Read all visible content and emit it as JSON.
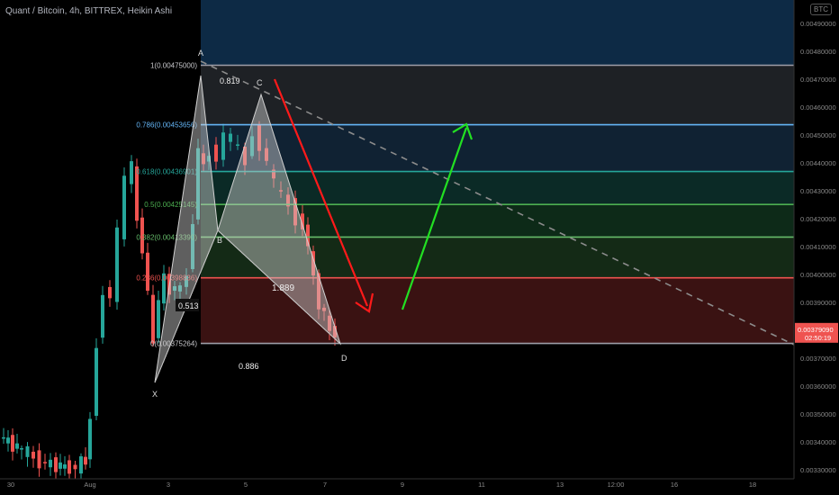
{
  "header": {
    "title": "Quant / Bitcoin, 4h, BITTREX, Heikin Ashi",
    "currency_button": "BTC"
  },
  "chart_data": {
    "type": "candlestick",
    "title": "Quant / Bitcoin, 4h, BITTREX, Heikin Ashi",
    "x_ticks": [
      "30",
      "Aug",
      "3",
      "5",
      "7",
      "9",
      "11",
      "13",
      "12:00",
      "16",
      "18"
    ],
    "y_ticks": [
      "0.00490000",
      "0.00480000",
      "0.00470000",
      "0.00460000",
      "0.00450000",
      "0.00440000",
      "0.00430000",
      "0.00420000",
      "0.00410000",
      "0.00400000",
      "0.00390000",
      "0.00380000",
      "0.00370000",
      "0.00360000",
      "0.00350000",
      "0.00340000",
      "0.00330000"
    ],
    "ylim": [
      0.0033,
      0.00495
    ],
    "last_price": "0.00379090",
    "countdown": "02:50:19",
    "fib_levels": [
      {
        "label": "1(0.00475000)",
        "value": 0.00475,
        "color": "#9e9ea8"
      },
      {
        "label": "0.786(0.00453656)",
        "value": 0.004537,
        "color": "#64b5f6"
      },
      {
        "label": "0.618(0.00436901)",
        "value": 0.004369,
        "color": "#26a69a"
      },
      {
        "label": "0.5(0.00425145)",
        "value": 0.004251,
        "color": "#4caf50"
      },
      {
        "label": "0.382(0.00413390)",
        "value": 0.004134,
        "color": "#66bb6a"
      },
      {
        "label": "0.236(0.00398836)",
        "value": 0.003988,
        "color": "#ef5350"
      },
      {
        "label": "0(0.00375264)",
        "value": 0.003753,
        "color": "#9e9ea8"
      }
    ],
    "pattern_points": {
      "X": "X",
      "A": "A",
      "B": "B",
      "C": "C",
      "D": "D"
    },
    "ratios": [
      "0.819",
      "0.513",
      "1.889",
      "0.886"
    ]
  },
  "colors": {
    "up": "#26a69a",
    "down": "#ef5350",
    "top_zone": "#0d2a45",
    "red_arrow": "#ff1a1a",
    "green_arrow": "#22e022"
  }
}
